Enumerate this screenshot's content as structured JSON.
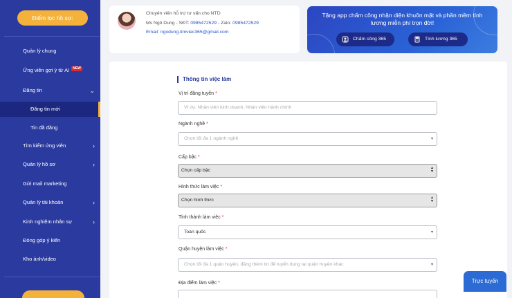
{
  "sidebar": {
    "top_button": "Điểm lọc hồ sơ:",
    "items": [
      {
        "label": "Quản lý chung"
      },
      {
        "label": "Ứng viên gợi ý từ AI",
        "badge": "NEW"
      },
      {
        "label": "Đăng tin"
      },
      {
        "label": "Đăng tin mới"
      },
      {
        "label": "Tin đã đăng"
      },
      {
        "label": "Tìm kiếm ứng viên"
      },
      {
        "label": "Quản lý hồ sơ"
      },
      {
        "label": "Gửi mail marketing"
      },
      {
        "label": "Quản lý tài khoản"
      },
      {
        "label": "Kinh nghiệm nhân sự"
      },
      {
        "label": "Đóng góp ý kiến"
      },
      {
        "label": "Kho ảnh/video"
      }
    ]
  },
  "contact": {
    "title": "Chuyên viên hỗ trợ tư vấn cho NTD",
    "name_prefix": "Ms Ngô Dung - SĐT: ",
    "phone": "0985472529",
    "zalo_prefix": " - Zalo: ",
    "zalo": "0985472529",
    "email": "Email: ngodung.timviec365@gmail.com"
  },
  "promo": {
    "text": "Tặng app chấm công nhận diện khuôn mặt và phần mềm tính lương miễn phí trọn đời!",
    "btn1": "Chấm công 365",
    "btn2": "Tính lương 365"
  },
  "form": {
    "section_title": "Thông tin việc làm",
    "fields": {
      "position": {
        "label": "Vị trí đăng tuyển",
        "placeholder": "Ví dụ: Nhân viên kinh doanh, Nhân viên hành chính"
      },
      "industry": {
        "label": "Ngành nghề",
        "value": "Chọn tối đa 1 ngành nghề"
      },
      "level": {
        "label": "Cấp bậc",
        "value": "Chọn cấp bậc"
      },
      "work_type": {
        "label": "Hình thức làm việc",
        "value": "Chọn hình thức"
      },
      "province": {
        "label": "Tỉnh thành làm việc",
        "value": "Toàn quốc"
      },
      "district": {
        "label": "Quận huyện làm việc",
        "value": "Chọn tối đa 1 quận huyện, đăng thêm tin để tuyển dụng tại quận huyện khác"
      },
      "address": {
        "label": "Địa điểm làm việc"
      }
    },
    "required_mark": "*"
  },
  "live_chat": "Trực tuyến"
}
